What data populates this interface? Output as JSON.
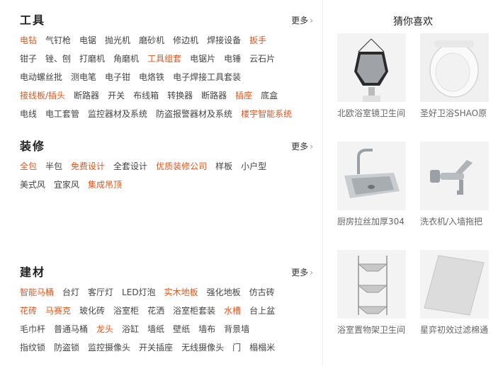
{
  "sections": [
    {
      "title": "工具",
      "more": "更多",
      "rows": [
        [
          {
            "t": "电钻",
            "hot": true
          },
          {
            "t": "气钉枪"
          },
          {
            "t": "电锯"
          },
          {
            "t": "抛光机"
          },
          {
            "t": "磨砂机"
          },
          {
            "t": "修边机"
          },
          {
            "t": "焊接设备"
          },
          {
            "t": "扳手",
            "hot": true
          }
        ],
        [
          {
            "t": "钳子"
          },
          {
            "t": "锉、刨"
          },
          {
            "t": "打磨机"
          },
          {
            "t": "角磨机"
          },
          {
            "t": "工具组套",
            "hot": true
          },
          {
            "t": "电锯片"
          },
          {
            "t": "电锤"
          },
          {
            "t": "云石片"
          }
        ],
        [
          {
            "t": "电动螺丝批"
          },
          {
            "t": "测电笔"
          },
          {
            "t": "电子钳"
          },
          {
            "t": "电烙铁"
          },
          {
            "t": "电子焊接工具套装"
          }
        ],
        [
          {
            "t": "接线板/插头",
            "hot": true
          },
          {
            "t": "断路器"
          },
          {
            "t": "开关"
          },
          {
            "t": "布线箱"
          },
          {
            "t": "转换器"
          },
          {
            "t": "断路器"
          },
          {
            "t": "插座",
            "hot": true
          },
          {
            "t": "底盒"
          }
        ],
        [
          {
            "t": "电线"
          },
          {
            "t": "电工套管"
          },
          {
            "t": "监控器材及系统"
          },
          {
            "t": "防盗报警器材及系统"
          },
          {
            "t": "楼宇智能系统",
            "hot": true
          }
        ]
      ]
    },
    {
      "title": "装修",
      "more": "更多",
      "rows": [
        [
          {
            "t": "全包",
            "hot": true
          },
          {
            "t": "半包"
          },
          {
            "t": "免费设计",
            "hot": true
          },
          {
            "t": "全套设计"
          },
          {
            "t": "优质装修公司",
            "hot": true
          },
          {
            "t": "样板"
          },
          {
            "t": "小户型"
          }
        ],
        [
          {
            "t": "美式风"
          },
          {
            "t": "宜家风"
          },
          {
            "t": "集成吊顶",
            "hot": true
          }
        ]
      ]
    },
    {
      "title": "建材",
      "more": "更多",
      "rows": [
        [
          {
            "t": "智能马桶",
            "hot": true
          },
          {
            "t": "台灯"
          },
          {
            "t": "客厅灯"
          },
          {
            "t": "LED灯泡"
          },
          {
            "t": "实木地板",
            "hot": true
          },
          {
            "t": "强化地板"
          },
          {
            "t": "仿古砖"
          }
        ],
        [
          {
            "t": "花砖",
            "hot": true
          },
          {
            "t": "马赛克",
            "hot": true
          },
          {
            "t": "玻化砖"
          },
          {
            "t": "浴室柜"
          },
          {
            "t": "花洒"
          },
          {
            "t": "浴室柜套装"
          },
          {
            "t": "水槽",
            "hot": true
          },
          {
            "t": "台上盆"
          }
        ],
        [
          {
            "t": "毛巾杆"
          },
          {
            "t": "普通马桶"
          },
          {
            "t": "龙头",
            "hot": true
          },
          {
            "t": "浴缸"
          },
          {
            "t": "墙纸"
          },
          {
            "t": "壁纸"
          },
          {
            "t": "墙布"
          },
          {
            "t": "背景墙"
          }
        ],
        [
          {
            "t": "指纹锁"
          },
          {
            "t": "防盗锁"
          },
          {
            "t": "监控摄像头"
          },
          {
            "t": "开关插座"
          },
          {
            "t": "无线摄像头"
          },
          {
            "t": "门"
          },
          {
            "t": "榻榻米"
          }
        ]
      ]
    }
  ],
  "recommend": {
    "title": "猜你喜欢",
    "items": [
      {
        "caption": "北欧浴室镜卫生间",
        "icon": "mirror-icon"
      },
      {
        "caption": "圣好卫浴SHAO原",
        "icon": "toilet-seat-icon"
      },
      {
        "caption": "厨房拉丝加厚304",
        "icon": "sink-icon"
      },
      {
        "caption": "洗衣机/入墙拖把",
        "icon": "faucet-icon"
      },
      {
        "caption": "浴室置物架卫生间",
        "icon": "shelf-icon"
      },
      {
        "caption": "星弈初效过滤棉通",
        "icon": "filter-cotton-icon"
      }
    ]
  },
  "colors": {
    "accent": "#e2541a",
    "text": "#444444",
    "divider": "#ececec",
    "thumb_bg": "#f2f2f2"
  }
}
